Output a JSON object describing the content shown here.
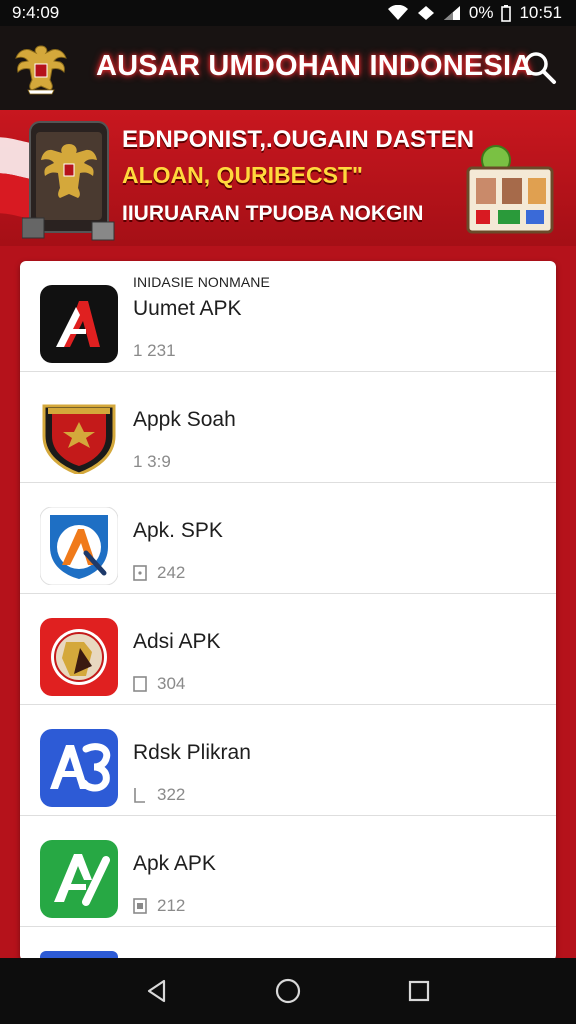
{
  "status_bar": {
    "left_time": "9:4:09",
    "battery": "0%",
    "clock": "10:51"
  },
  "app_bar": {
    "title": "AUSAR UMDOHAN INDONESIA"
  },
  "banner": {
    "line1": "EDNPONIST,.OUGAIN DASTEN",
    "line2": "ALOAN, QURIBECST\"",
    "line3": "IIURUARAN TPUOBA NOKGIN"
  },
  "list": {
    "section_header": "INIDASIE NONMANE",
    "items": [
      {
        "name": "Uumet APK",
        "meta": "1   231",
        "icon": "red-a-icon"
      },
      {
        "name": "Appk Soah",
        "meta": "1   3:9",
        "icon": "shield-emblem-icon"
      },
      {
        "name": "Apk. SPK",
        "meta": "242",
        "icon": "blue-compass-a-icon"
      },
      {
        "name": "Adsi APK",
        "meta": "304",
        "icon": "red-garuda-emblem-icon"
      },
      {
        "name": "Rdsk Plikran",
        "meta": "322",
        "icon": "blue-a3-icon"
      },
      {
        "name": "Apk APK",
        "meta": "212",
        "icon": "green-a-icon"
      }
    ]
  },
  "colors": {
    "accent_red": "#b5121b",
    "app_bar_bg": "#181312",
    "banner_yellow": "#ffd93d"
  }
}
